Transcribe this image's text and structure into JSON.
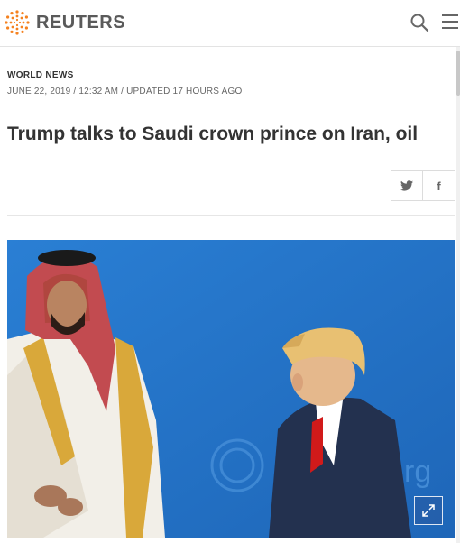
{
  "brand": {
    "name": "REUTERS",
    "accent_color": "#f58220",
    "text_color": "#5a5a5a"
  },
  "header": {
    "search_icon": "search-icon",
    "menu_icon": "hamburger-menu-icon"
  },
  "article": {
    "section": "WORLD NEWS",
    "dateline": "JUNE 22, 2019 / 12:32 AM / UPDATED 17 HOURS AGO",
    "headline": "Trump talks to Saudi crown prince on Iran, oil"
  },
  "share": {
    "twitter_glyph": "🐦",
    "facebook_glyph": "f"
  },
  "photo": {
    "background_color": "#2f80cf",
    "expand_icon": "expand-icon"
  }
}
